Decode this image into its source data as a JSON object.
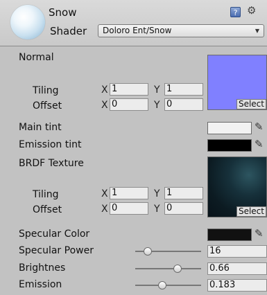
{
  "material": {
    "name": "Snow",
    "shader_label": "Shader",
    "shader_value": "Doloro Ent/Snow",
    "help_icon_glyph": "?",
    "gear_icon_glyph": "⚙"
  },
  "normal": {
    "label": "Normal",
    "tiling_label": "Tiling",
    "offset_label": "Offset",
    "tiling_x": "1",
    "tiling_y": "1",
    "offset_x": "0",
    "offset_y": "0",
    "select_label": "Select",
    "color": "#8080ff"
  },
  "main_tint": {
    "label": "Main tint",
    "color": "#f2f2f2"
  },
  "emission_tint": {
    "label": "Emission tint",
    "color": "#000000"
  },
  "brdf": {
    "label": "BRDF Texture",
    "tiling_label": "Tiling",
    "offset_label": "Offset",
    "tiling_x": "1",
    "tiling_y": "1",
    "offset_x": "0",
    "offset_y": "0",
    "select_label": "Select"
  },
  "axis": {
    "x": "X",
    "y": "Y"
  },
  "specular_color": {
    "label": "Specular Color",
    "color": "#111111"
  },
  "specular_power": {
    "label": "Specular Power",
    "value": "16",
    "fraction": 0.15
  },
  "brightnes": {
    "label": "Brightnes",
    "value": "0.66",
    "fraction": 0.66
  },
  "emission": {
    "label": "Emission",
    "value": "0.183",
    "fraction": 0.4
  },
  "picker_icon_glyph": "✎"
}
